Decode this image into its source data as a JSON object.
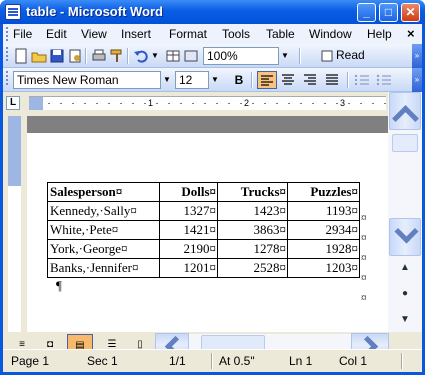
{
  "window": {
    "title": "table - Microsoft Word"
  },
  "menu": {
    "items": [
      {
        "label": "File"
      },
      {
        "label": "Edit"
      },
      {
        "label": "View"
      },
      {
        "label": "Insert"
      },
      {
        "label": "Format"
      },
      {
        "label": "Tools"
      },
      {
        "label": "Table"
      },
      {
        "label": "Window"
      },
      {
        "label": "Help"
      }
    ],
    "close_glyph": "×"
  },
  "standard_toolbar": {
    "zoom": "100%",
    "read_label": "Read"
  },
  "formatting_toolbar": {
    "font": "Times New Roman",
    "size": "12",
    "bold_label": "B"
  },
  "ruler": {
    "tab_selector": "L",
    "numbers": [
      "1",
      "2",
      "3"
    ]
  },
  "table": {
    "headers": [
      "Salesperson¤",
      "Dolls¤",
      "Trucks¤",
      "Puzzles¤"
    ],
    "rows": [
      [
        "Kennedy,·Sally¤",
        "1327¤",
        "1423¤",
        "1193¤"
      ],
      [
        "White,·Pete¤",
        "1421¤",
        "3863¤",
        "2934¤"
      ],
      [
        "York,·George¤",
        "2190¤",
        "1278¤",
        "1928¤"
      ],
      [
        "Banks,·Jennifer¤",
        "1201¤",
        "2528¤",
        "1203¤"
      ]
    ],
    "row_end_mark": "¤"
  },
  "paragraph_mark": "¶",
  "status": {
    "page": "Page 1",
    "section": "Sec 1",
    "page_of": "1/1",
    "at": "At 0.5\"",
    "line": "Ln 1",
    "column": "Col 1"
  },
  "colors": {
    "title_bar": "#0a5de6",
    "active_button": "#f7c37e",
    "menu_bg": "#eef2fc"
  }
}
